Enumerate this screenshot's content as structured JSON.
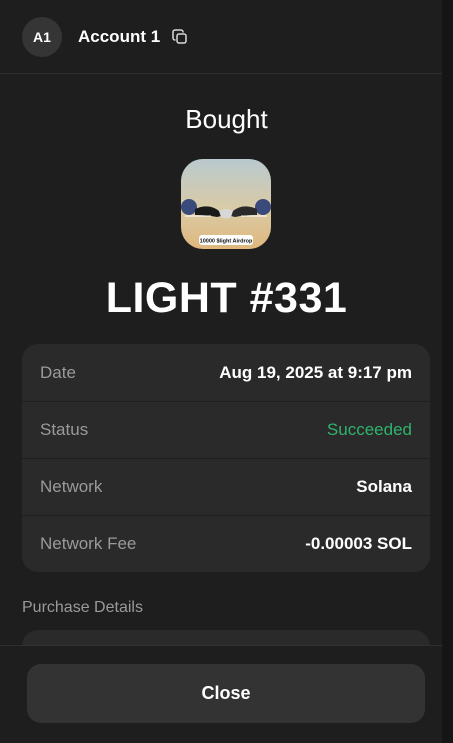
{
  "header": {
    "avatar_initials": "A1",
    "account_name": "Account 1",
    "copy_icon": "copy-icon"
  },
  "title": "Bought",
  "nft": {
    "image_icon": "handshake-nft-image",
    "image_caption": "10000 $light Airdrop",
    "name": "LIGHT #331"
  },
  "details": [
    {
      "label": "Date",
      "value": "Aug 19, 2025 at 9:17 pm"
    },
    {
      "label": "Status",
      "value": "Succeeded"
    },
    {
      "label": "Network",
      "value": "Solana"
    },
    {
      "label": "Network Fee",
      "value": "-0.00003 SOL"
    }
  ],
  "purchase_details_label": "Purchase Details",
  "close_label": "Close",
  "colors": {
    "background": "#1e1e1e",
    "card": "#2a2a2a",
    "success": "#2fb36d",
    "muted": "#9a9a9a"
  }
}
